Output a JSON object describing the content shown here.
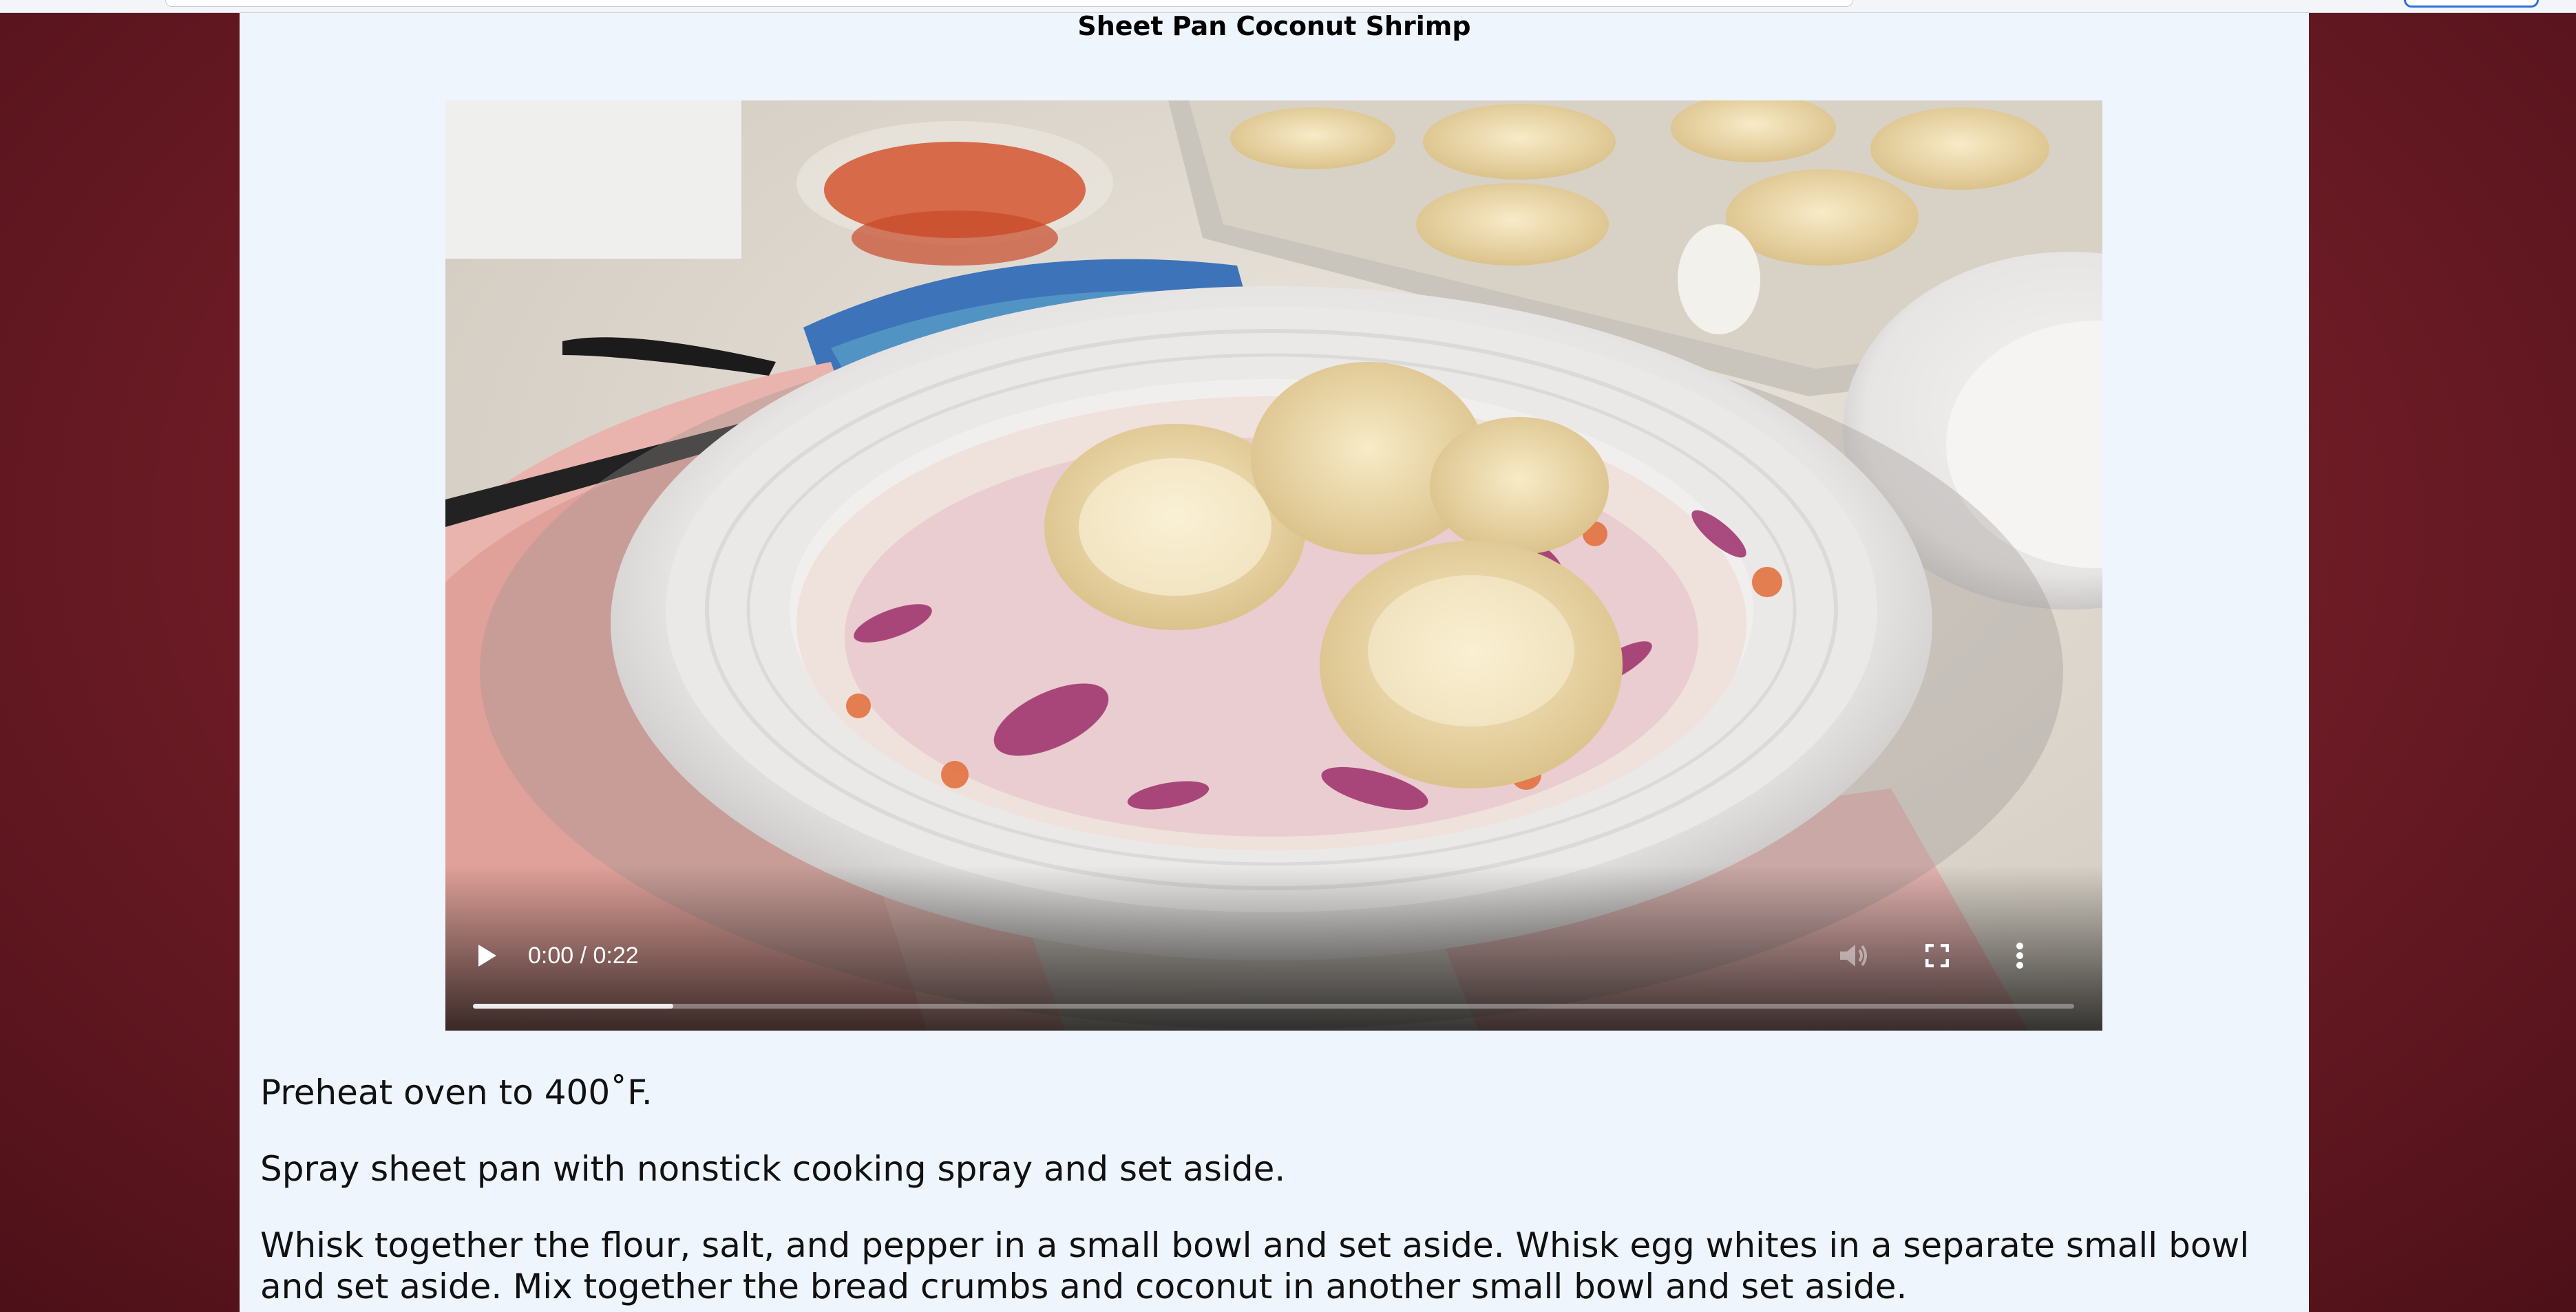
{
  "recipe": {
    "title": "Sheet Pan Coconut Shrimp",
    "steps": [
      "Preheat oven to 400˚F.",
      "Spray sheet pan with nonstick cooking spray and set aside.",
      "Whisk together the flour, salt, and pepper in a small bowl and set aside. Whisk egg whites in a separate small bowl and set aside. Mix together the bread crumbs and coconut in another small bowl and set aside."
    ]
  },
  "video": {
    "time_display": "0:00 / 0:22",
    "buffered_fraction": 0.125,
    "icons": {
      "play": "play-icon",
      "volume": "volume-icon",
      "fullscreen": "fullscreen-icon",
      "more": "more-options-icon"
    }
  },
  "colors": {
    "page_background": "#eef5fd",
    "backdrop": "#6e1c26"
  }
}
